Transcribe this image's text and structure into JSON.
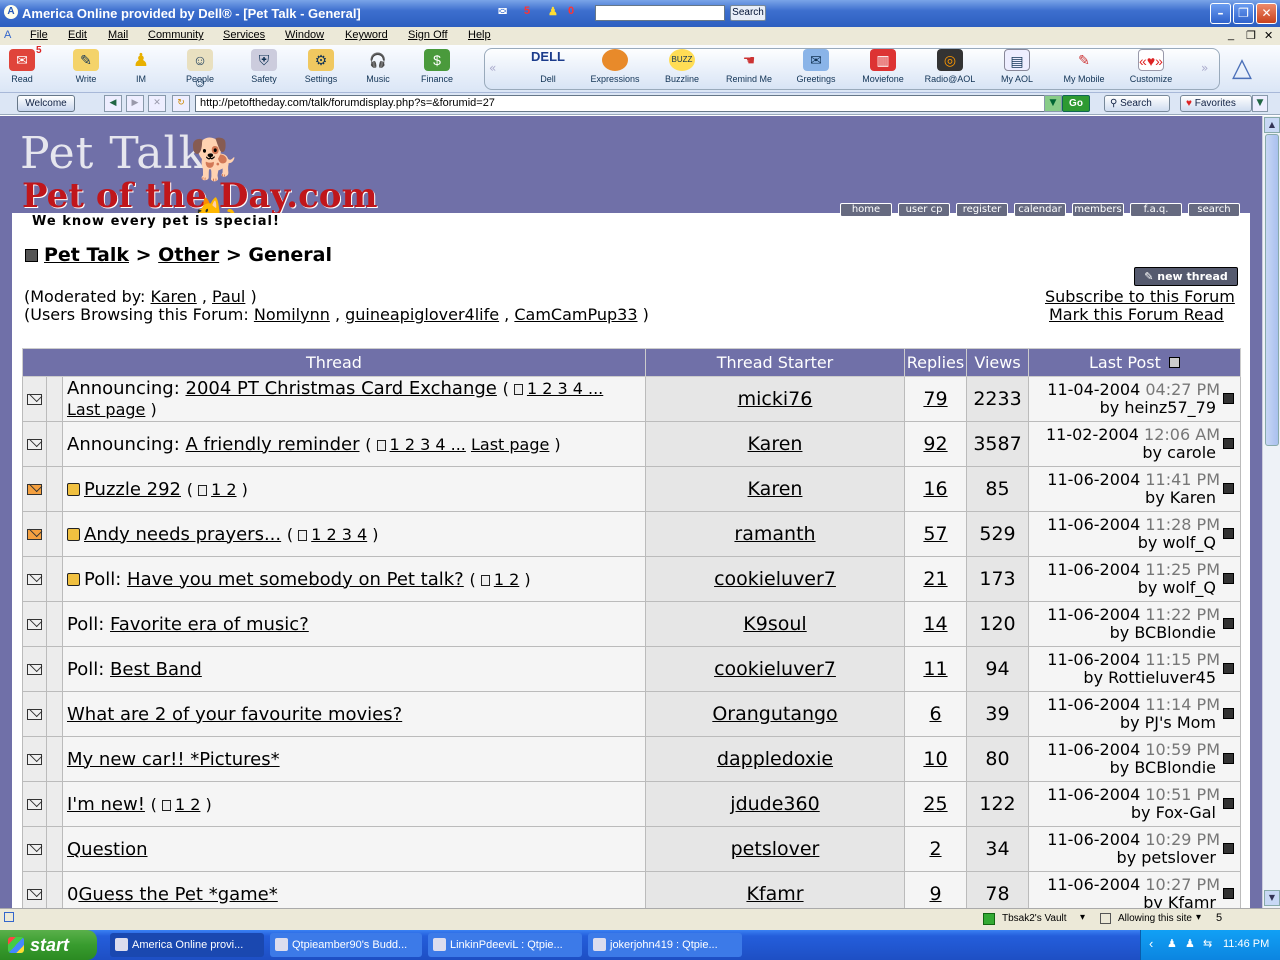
{
  "window": {
    "title": "America  Online provided by Dell® - [Pet Talk - General]",
    "mail_count": "5",
    "buddy_count": "0",
    "search_label": "Search"
  },
  "menu": [
    "File",
    "Edit",
    "Mail",
    "Community",
    "Services",
    "Window",
    "Keyword",
    "Sign Off",
    "Help"
  ],
  "toolbar_left": [
    {
      "label": "Read",
      "icon": "mailbox-icon"
    },
    {
      "label": "Write",
      "icon": "pencil-icon"
    },
    {
      "label": "IM",
      "icon": "running-man-icon"
    },
    {
      "label": "People",
      "icon": "people-icon"
    },
    {
      "label": "Safety",
      "icon": "shield-icon"
    },
    {
      "label": "Settings",
      "icon": "settings-icon"
    },
    {
      "label": "Music",
      "icon": "headphones-icon"
    },
    {
      "label": "Finance",
      "icon": "money-icon"
    }
  ],
  "read_badge": "5",
  "toolbar_dell": [
    {
      "label": "Dell",
      "icon": "dell-logo-icon"
    },
    {
      "label": "Expressions",
      "icon": "expressions-icon"
    },
    {
      "label": "Buzzline",
      "icon": "buzzline-icon"
    },
    {
      "label": "Remind Me",
      "icon": "remind-icon"
    },
    {
      "label": "Greetings",
      "icon": "greetings-icon"
    },
    {
      "label": "Moviefone",
      "icon": "popcorn-icon"
    },
    {
      "label": "Radio@AOL",
      "icon": "radio-icon"
    },
    {
      "label": "My AOL",
      "icon": "myaol-icon"
    },
    {
      "label": "My Mobile",
      "icon": "mobile-icon"
    },
    {
      "label": "Customize",
      "icon": "customize-icon"
    }
  ],
  "address": {
    "welcome": "Welcome",
    "url": "http://petoftheday.com/talk/forumdisplay.php?s=&forumid=27",
    "go": "Go",
    "search": "Search",
    "favorites": "Favorites"
  },
  "site": {
    "logo_top": "Pet Talk",
    "logo_bottom": "Pet of the Day.com",
    "tagline": "We know every pet is special!",
    "nav": [
      "home",
      "user cp",
      "register",
      "calendar",
      "members",
      "f.a.q.",
      "search"
    ],
    "new_thread": "new thread"
  },
  "breadcrumb": {
    "root": "Pet Talk",
    "sep": ">",
    "mid": "Other",
    "current": "General"
  },
  "moderated_prefix": "(Moderated by:",
  "moderators": [
    "Karen",
    "Paul"
  ],
  "browsing_prefix": "(Users Browsing this Forum:",
  "browsing": [
    "Nomilynn",
    "guineapiglover4life",
    "CamCamPup33"
  ],
  "subscribe": "Subscribe to this Forum",
  "mark_read": "Mark this Forum Read",
  "columns": {
    "thread": "Thread",
    "starter": "Thread Starter",
    "replies": "Replies",
    "views": "Views",
    "last_post": "Last Post"
  },
  "threads": [
    {
      "prefix": "Announcing:",
      "title": "2004 PT Christmas Card Exchange",
      "pages": "1 2 3 4 ...",
      "last_page": "Last page",
      "wrap": true,
      "starter": "micki76",
      "replies": "79",
      "views": "2233",
      "date": "11-04-2004",
      "time": "04:27 PM",
      "by": "heinz57_79",
      "hot": false,
      "icon": false
    },
    {
      "prefix": "Announcing:",
      "title": "A friendly reminder",
      "pages": "1 2 3 4 ...",
      "last_page": "Last page",
      "wrap": false,
      "starter": "Karen",
      "replies": "92",
      "views": "3587",
      "date": "11-02-2004",
      "time": "12:06 AM",
      "by": "carole",
      "hot": false,
      "icon": false
    },
    {
      "prefix": "",
      "title": "Puzzle 292",
      "pages": "1 2",
      "last_page": "",
      "starter": "Karen",
      "replies": "16",
      "views": "85",
      "date": "11-06-2004",
      "time": "11:41 PM",
      "by": "Karen",
      "hot": true,
      "icon": true
    },
    {
      "prefix": "",
      "title": "Andy needs prayers...",
      "pages": "1 2 3 4",
      "last_page": "",
      "starter": "ramanth",
      "replies": "57",
      "views": "529",
      "date": "11-06-2004",
      "time": "11:28 PM",
      "by": "wolf_Q",
      "hot": true,
      "icon": true
    },
    {
      "prefix": "Poll:",
      "title": "Have you met somebody on Pet talk?",
      "pages": "1 2",
      "last_page": "",
      "starter": "cookieluver7",
      "replies": "21",
      "views": "173",
      "date": "11-06-2004",
      "time": "11:25 PM",
      "by": "wolf_Q",
      "hot": false,
      "icon": true
    },
    {
      "prefix": "Poll:",
      "title": "Favorite era of music?",
      "pages": "",
      "last_page": "",
      "starter": "K9soul",
      "replies": "14",
      "views": "120",
      "date": "11-06-2004",
      "time": "11:22 PM",
      "by": "BCBlondie",
      "hot": false,
      "icon": false
    },
    {
      "prefix": "Poll:",
      "title": "Best Band",
      "pages": "",
      "last_page": "",
      "starter": "cookieluver7",
      "replies": "11",
      "views": "94",
      "date": "11-06-2004",
      "time": "11:15 PM",
      "by": "Rottieluver45",
      "hot": false,
      "icon": false
    },
    {
      "prefix": "",
      "title": "What are 2 of your favourite movies?",
      "pages": "",
      "last_page": "",
      "starter": "Orangutango",
      "replies": "6",
      "views": "39",
      "date": "11-06-2004",
      "time": "11:14 PM",
      "by": "PJ's Mom",
      "hot": false,
      "icon": false
    },
    {
      "prefix": "",
      "title": "My new car!! *Pictures*",
      "pages": "",
      "last_page": "",
      "starter": "dappledoxie",
      "replies": "10",
      "views": "80",
      "date": "11-06-2004",
      "time": "10:59 PM",
      "by": "BCBlondie",
      "hot": false,
      "icon": false
    },
    {
      "prefix": "",
      "title": "I'm new!",
      "pages": "1 2",
      "last_page": "",
      "starter": "jdude360",
      "replies": "25",
      "views": "122",
      "date": "11-06-2004",
      "time": "10:51 PM",
      "by": "Fox-Gal",
      "hot": false,
      "icon": false
    },
    {
      "prefix": "",
      "title": "Question",
      "pages": "",
      "last_page": "",
      "starter": "petslover",
      "replies": "2",
      "views": "34",
      "date": "11-06-2004",
      "time": "10:29 PM",
      "by": "petslover",
      "hot": false,
      "icon": false
    },
    {
      "prefix": "0",
      "title": "Guess the Pet *game*",
      "pages": "",
      "last_page": "",
      "starter": "Kfamr",
      "replies": "9",
      "views": "78",
      "date": "11-06-2004",
      "time": "10:27 PM",
      "by": "Kfamr",
      "hot": false,
      "icon": false
    }
  ],
  "status": {
    "vault": "Tbsak2's Vault",
    "allowing": "Allowing this site",
    "num": "5"
  },
  "taskbar": {
    "start": "start",
    "tasks": [
      "America  Online provi...",
      "Qtpieamber90's Budd...",
      "LinkinPdeeviL : Qtpie...",
      "jokerjohn419 : Qtpie..."
    ],
    "clock": "11:46 PM"
  },
  "colors": {
    "forum_header": "#7070a8",
    "page_bg": "#7070a8"
  }
}
